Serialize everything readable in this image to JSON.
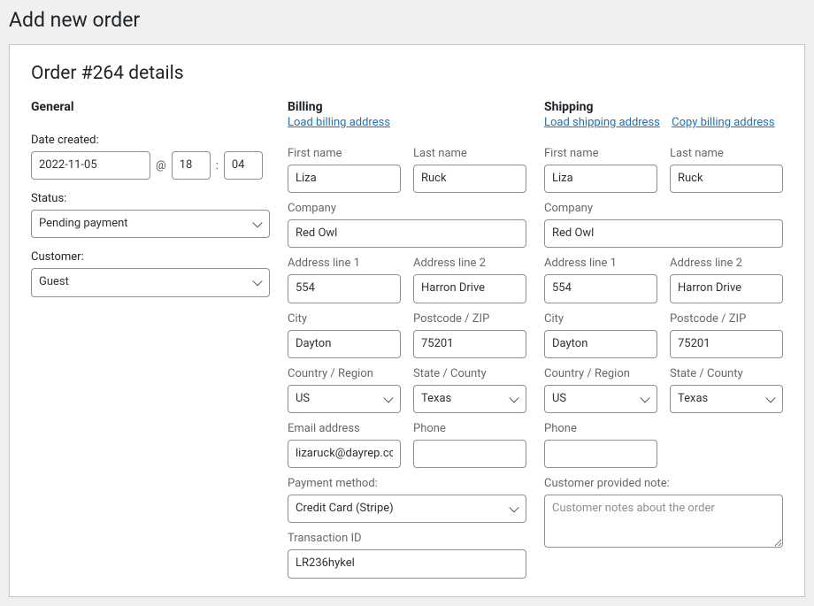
{
  "page_title": "Add new order",
  "panel_title": "Order #264 details",
  "general": {
    "heading": "General",
    "date_label": "Date created:",
    "date": "2022-11-05",
    "at": "@",
    "hour": "18",
    "colon": ":",
    "minute": "04",
    "status_label": "Status:",
    "status_value": "Pending payment",
    "customer_label": "Customer:",
    "customer_value": "Guest"
  },
  "billing": {
    "heading": "Billing",
    "load_link": "Load billing address",
    "first_name_label": "First name",
    "first_name": "Liza",
    "last_name_label": "Last name",
    "last_name": "Ruck",
    "company_label": "Company",
    "company": "Red Owl",
    "addr1_label": "Address line 1",
    "addr1": "554",
    "addr2_label": "Address line 2",
    "addr2": "Harron Drive",
    "city_label": "City",
    "city": "Dayton",
    "postcode_label": "Postcode / ZIP",
    "postcode": "75201",
    "country_label": "Country / Region",
    "country": "US",
    "state_label": "State / County",
    "state": "Texas",
    "email_label": "Email address",
    "email": "lizaruck@dayrep.com",
    "phone_label": "Phone",
    "phone": "",
    "payment_method_label": "Payment method:",
    "payment_method": "Credit Card (Stripe)",
    "transaction_id_label": "Transaction ID",
    "transaction_id": "LR236hykel"
  },
  "shipping": {
    "heading": "Shipping",
    "load_link": "Load shipping address",
    "copy_link": "Copy billing address",
    "first_name_label": "First name",
    "first_name": "Liza",
    "last_name_label": "Last name",
    "last_name": "Ruck",
    "company_label": "Company",
    "company": "Red Owl",
    "addr1_label": "Address line 1",
    "addr1": "554",
    "addr2_label": "Address line 2",
    "addr2": "Harron Drive",
    "city_label": "City",
    "city": "Dayton",
    "postcode_label": "Postcode / ZIP",
    "postcode": "75201",
    "country_label": "Country / Region",
    "country": "US",
    "state_label": "State / County",
    "state": "Texas",
    "phone_label": "Phone",
    "phone": "",
    "note_label": "Customer provided note:",
    "note_placeholder": "Customer notes about the order"
  }
}
